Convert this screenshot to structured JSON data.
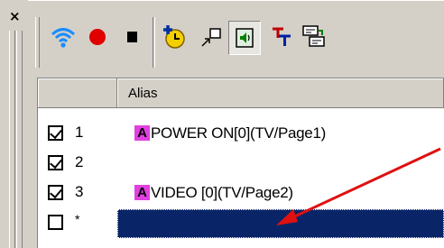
{
  "window": {
    "close_glyph": "×"
  },
  "toolbar": {
    "buttons": [
      {
        "name": "wifi-icon"
      },
      {
        "name": "record-icon",
        "color": "#e00000"
      },
      {
        "name": "stop-icon"
      },
      {
        "name": "add-timer-icon"
      },
      {
        "name": "resize-arrow-icon"
      },
      {
        "name": "speaker-icon"
      },
      {
        "name": "text-icon",
        "label": "T"
      },
      {
        "name": "keyboard-icon"
      }
    ]
  },
  "table": {
    "column_header": "Alias",
    "rows": [
      {
        "checked": true,
        "num": "1",
        "badge": "A",
        "alias": "POWER ON[0](TV/Page1)"
      },
      {
        "checked": true,
        "num": "2",
        "badge": "",
        "alias": ""
      },
      {
        "checked": true,
        "num": "3",
        "badge": "A",
        "alias": "VIDEO [0](TV/Page2)"
      },
      {
        "checked": false,
        "num": "*",
        "badge": "",
        "alias": "",
        "selected": true
      }
    ]
  },
  "colors": {
    "selection": "#0a2468",
    "badge": "#e040e0",
    "annotation_arrow": "#e01010"
  }
}
